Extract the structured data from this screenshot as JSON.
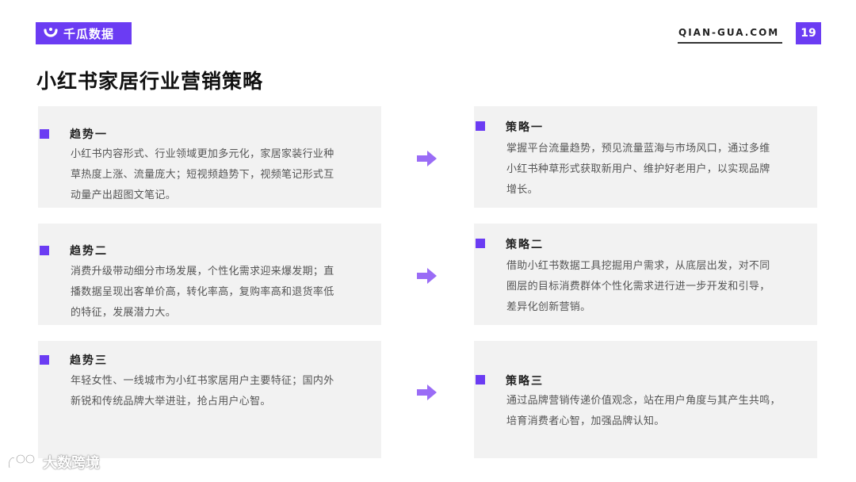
{
  "header": {
    "logo_text": "千瓜数据",
    "site_url": "QIAN-GUA.COM",
    "page_number": "19"
  },
  "title": "小红书家居行业营销策略",
  "trends": [
    {
      "heading": "趋势一",
      "lines": [
        "小红书内容形式、行业领域更加多元化，家居家装行业种",
        "草热度上涨、流量庞大；短视频趋势下，视频笔记形式互",
        "动量产出超图文笔记。"
      ]
    },
    {
      "heading": "趋势二",
      "lines": [
        "消费升级带动细分市场发展，个性化需求迎来爆发期；直",
        "播数据呈现出客单价高，转化率高，复购率高和退货率低",
        "的特征，发展潜力大。"
      ]
    },
    {
      "heading": "趋势三",
      "lines": [
        "年轻女性、一线城市为小红书家居用户主要特征；国内外",
        "新锐和传统品牌大举进驻，抢占用户心智。"
      ]
    }
  ],
  "strategies": [
    {
      "heading": "策略一",
      "lines": [
        "掌握平台流量趋势，预见流量蓝海与市场风口，通过多维",
        "小红书种草形式获取新用户、维护好老用户，以实现品牌",
        "增长。"
      ]
    },
    {
      "heading": "策略二",
      "lines": [
        "借助小红书数据工具挖掘用户需求，从底层出发，对不同",
        "圈层的目标消费群体个性化需求进行进一步开发和引导，",
        "差异化创新营销。"
      ]
    },
    {
      "heading": "策略三",
      "lines": [
        "通过品牌营销传递价值观念，站在用户角度与其产生共鸣，",
        "培育消费者心智，加强品牌认知。"
      ]
    }
  ],
  "watermark": {
    "text": "大数跨境"
  },
  "colors": {
    "accent": "#6b3cf3",
    "arrow": "#9a6cf6",
    "card_bg": "#f2f2f2"
  }
}
